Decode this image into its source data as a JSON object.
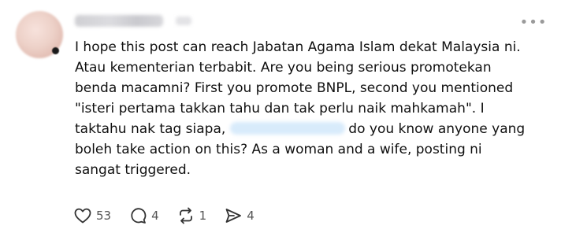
{
  "post": {
    "text_lines": [
      "I hope this post can reach Jabatan Agama Islam dekat Malaysia ni.",
      "Atau kementerian terbabit. Are you being serious promotekan",
      "benda macamni? First you promote BNPL, second you mentioned",
      "\"isteri pertama takkan tahu dan tak perlu naik mahkamah\". I",
      "taktahu nak tag siapa,",
      "do you know anyone yang",
      "boleh take action on this? As a woman and a wife, posting ni",
      "sangat triggered."
    ],
    "more_icon": "•••"
  },
  "actions": {
    "like": {
      "icon": "heart-icon",
      "count": "53"
    },
    "reply": {
      "icon": "comment-icon",
      "count": "4"
    },
    "repost": {
      "icon": "repost-icon",
      "count": "1"
    },
    "share": {
      "icon": "send-icon",
      "count": "4"
    }
  }
}
